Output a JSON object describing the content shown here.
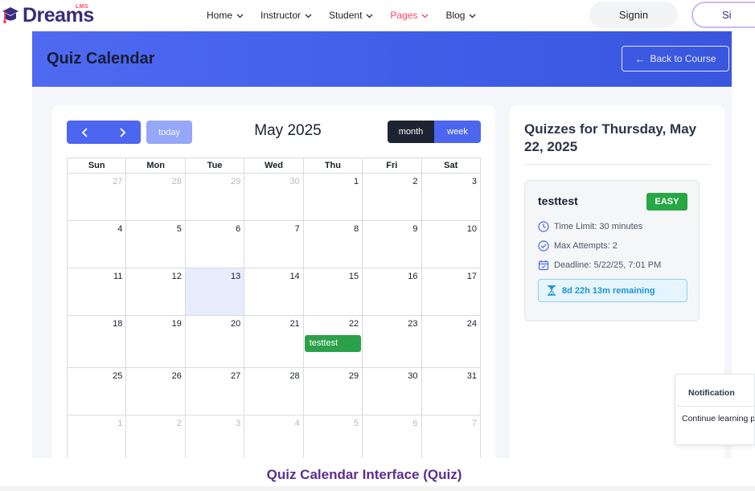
{
  "brand": {
    "name": "Dreams",
    "tag": "LMS"
  },
  "nav": {
    "items": [
      {
        "label": "Home",
        "active": false
      },
      {
        "label": "Instructor",
        "active": false
      },
      {
        "label": "Student",
        "active": false
      },
      {
        "label": "Pages",
        "active": true
      },
      {
        "label": "Blog",
        "active": false
      }
    ],
    "signin": "Signin",
    "signup": "Si"
  },
  "banner": {
    "title": "Quiz Calendar",
    "back_label": "Back to Course"
  },
  "calendar": {
    "prev_icon": "chevron-left-icon",
    "next_icon": "chevron-right-icon",
    "today_label": "today",
    "title": "May 2025",
    "views": {
      "month": "month",
      "week": "week"
    },
    "weekdays": [
      "Sun",
      "Mon",
      "Tue",
      "Wed",
      "Thu",
      "Fri",
      "Sat"
    ],
    "weeks": [
      [
        {
          "d": "27",
          "o": true
        },
        {
          "d": "28",
          "o": true
        },
        {
          "d": "29",
          "o": true
        },
        {
          "d": "30",
          "o": true
        },
        {
          "d": "1"
        },
        {
          "d": "2"
        },
        {
          "d": "3"
        }
      ],
      [
        {
          "d": "4"
        },
        {
          "d": "5"
        },
        {
          "d": "6"
        },
        {
          "d": "7"
        },
        {
          "d": "8"
        },
        {
          "d": "9"
        },
        {
          "d": "10"
        }
      ],
      [
        {
          "d": "11"
        },
        {
          "d": "12"
        },
        {
          "d": "13",
          "today": true
        },
        {
          "d": "14"
        },
        {
          "d": "15"
        },
        {
          "d": "16"
        },
        {
          "d": "17"
        }
      ],
      [
        {
          "d": "18"
        },
        {
          "d": "19"
        },
        {
          "d": "20"
        },
        {
          "d": "21"
        },
        {
          "d": "22",
          "event": "testtest"
        },
        {
          "d": "23"
        },
        {
          "d": "24"
        }
      ],
      [
        {
          "d": "25"
        },
        {
          "d": "26"
        },
        {
          "d": "27"
        },
        {
          "d": "28"
        },
        {
          "d": "29"
        },
        {
          "d": "30"
        },
        {
          "d": "31"
        }
      ],
      [
        {
          "d": "1",
          "o": true
        },
        {
          "d": "2",
          "o": true
        },
        {
          "d": "3",
          "o": true
        },
        {
          "d": "4",
          "o": true
        },
        {
          "d": "5",
          "o": true
        },
        {
          "d": "6",
          "o": true
        },
        {
          "d": "7",
          "o": true
        }
      ]
    ]
  },
  "quizzes": {
    "heading": "Quizzes for Thursday, May 22, 2025",
    "items": [
      {
        "name": "testtest",
        "difficulty": "EASY",
        "time_limit": "Time Limit: 30 minutes",
        "max_attempts": "Max Attempts: 2",
        "deadline": "Deadline: 5/22/25, 7:01 PM",
        "remaining": "8d 22h 13m remaining"
      }
    ]
  },
  "notification": {
    "title": "Notification",
    "body": "Continue learning progress."
  },
  "caption": "Quiz Calendar Interface (Quiz)",
  "colors": {
    "primary": "#4c66f0",
    "event": "#2aa04a",
    "today": "#e8edfd",
    "active_nav": "#ff4667",
    "caption": "#5b2d91"
  }
}
